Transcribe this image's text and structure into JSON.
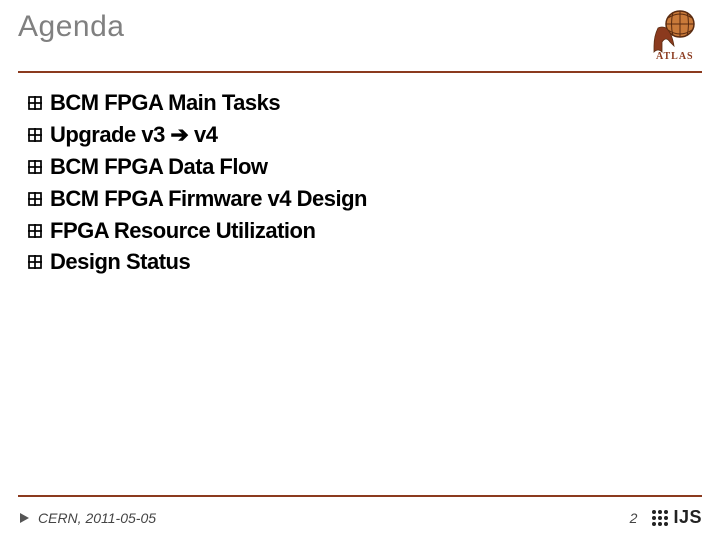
{
  "header": {
    "title": "Agenda",
    "logo_alt": "ATLAS"
  },
  "items": [
    "BCM FPGA Main Tasks",
    "Upgrade v3 ➔ v4",
    "BCM FPGA Data Flow",
    "BCM FPGA Firmware v4 Design",
    "FPGA Resource Utilization",
    "Design Status"
  ],
  "footer": {
    "location_date": "CERN, 2011-05-05",
    "page_number": "2",
    "institute": "IJS"
  },
  "colors": {
    "accent": "#8B3A1E",
    "title_gray": "#808080"
  }
}
